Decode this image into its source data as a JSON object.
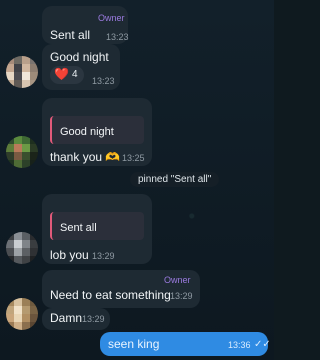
{
  "messages": [
    {
      "text": "Sent all",
      "time": "13:23",
      "badge": "Owner"
    },
    {
      "text": "Good night",
      "time": "13:23",
      "reaction_emoji": "❤️",
      "reaction_count": "4"
    },
    {
      "quote": "Good night",
      "text": "thank you 🫶",
      "time": "13:25"
    },
    {
      "system": "pinned \"Sent all\""
    },
    {
      "quote": "Sent all",
      "text": "lob you",
      "time": "13:29"
    },
    {
      "badge": "Owner",
      "text": "Need to eat something",
      "time": "13:29"
    },
    {
      "text": "Damn",
      "time": "13:29"
    }
  ],
  "outgoing": {
    "text": "seen king",
    "time": "13:36",
    "status": "✓✓"
  }
}
